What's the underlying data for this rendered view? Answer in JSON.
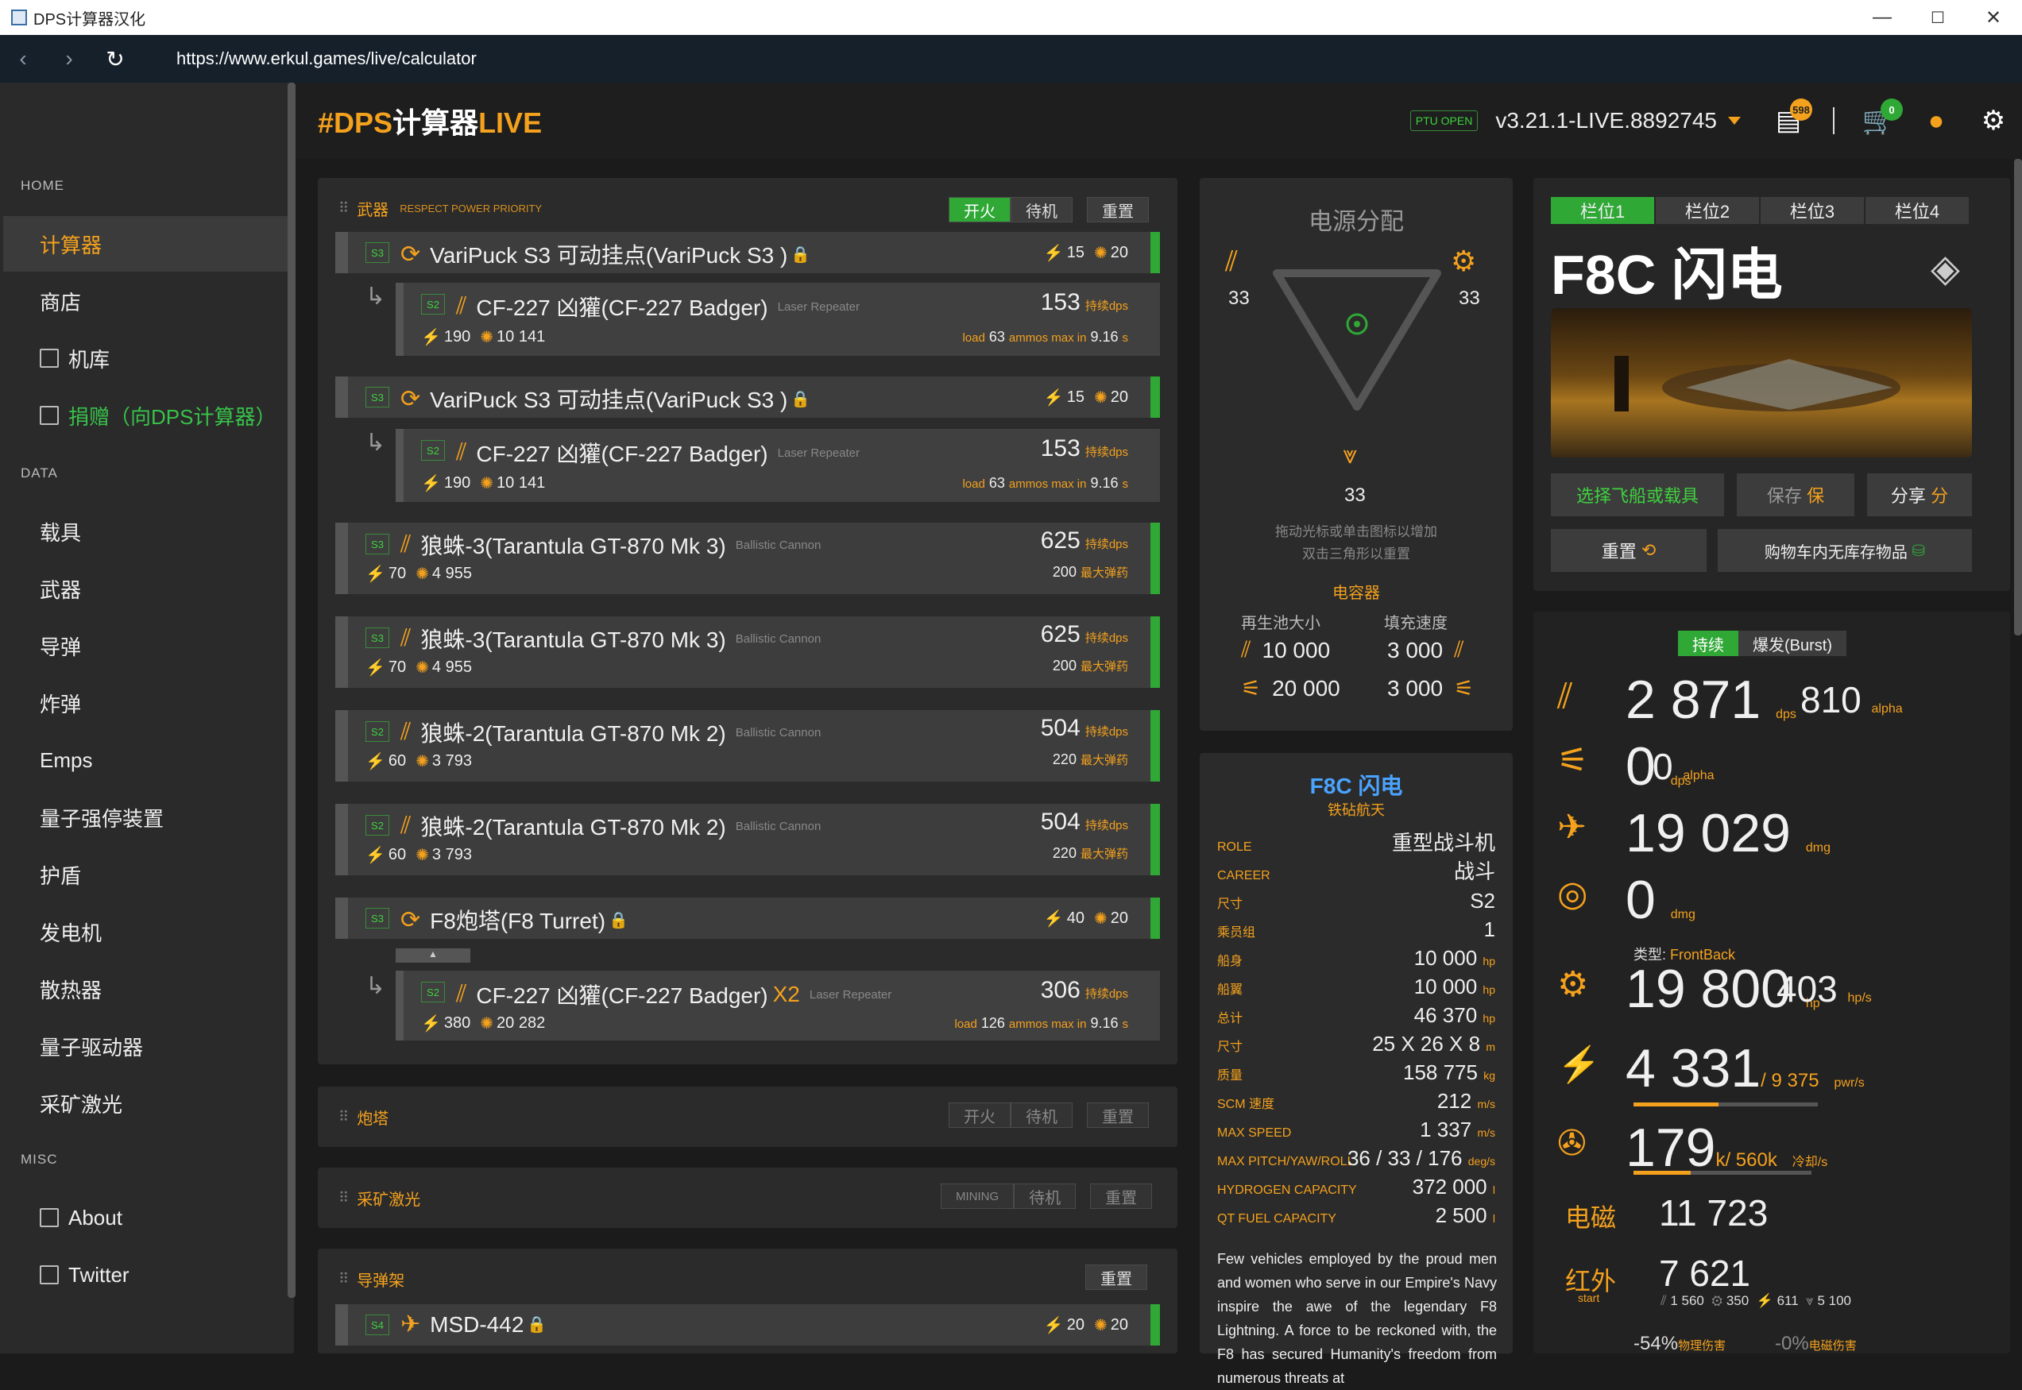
{
  "window": {
    "title": "DPS计算器汉化",
    "controls": [
      "—",
      "☐",
      "✕"
    ]
  },
  "browser": {
    "url": "https://www.erkul.games/live/calculator",
    "back": "‹",
    "forward": "›",
    "reload": "↻"
  },
  "sidebar": {
    "home_label": "HOME",
    "data_label": "DATA",
    "misc_label": "MISC",
    "home_items": [
      "计算器",
      "商店",
      "机库",
      "捐赠（向DPS计算器）"
    ],
    "data_items": [
      "载具",
      "武器",
      "导弹",
      "炸弹",
      "Emps",
      "量子强停装置",
      "护盾",
      "发电机",
      "散热器",
      "量子驱动器",
      "采矿激光"
    ],
    "misc_items": [
      "About",
      "Twitter"
    ]
  },
  "header": {
    "logo_hash": "#DPS",
    "logo_cn": "计算器",
    "logo_live": "LIVE",
    "ptu": "PTU OPEN",
    "version": "v3.21.1-LIVE.8892745",
    "notif_count": "598",
    "cart_count": "0"
  },
  "weapons": {
    "title": "武器",
    "subtitle": "RESPECT POWER PRIORITY",
    "fire": "开火",
    "standby": "待机",
    "reset": "重置",
    "mounts": [
      {
        "size": "S3",
        "name": "VariPuck S3 可动挂点(VariPuck S3 )",
        "power": "15",
        "heat": "20"
      },
      {
        "size": "S3",
        "name": "VariPuck S3 可动挂点(VariPuck S3 )",
        "power": "15",
        "heat": "20"
      },
      {
        "size": "S3",
        "name": "F8炮塔(F8 Turret)",
        "power": "40",
        "heat": "20"
      }
    ],
    "guns": [
      {
        "size": "S2",
        "name": "CF-227 凶獾(CF-227 Badger)",
        "type": "Laser Repeater",
        "dps": "153",
        "dps_label": "持续dps",
        "power": "190",
        "heat": "10 141",
        "load_label": "load",
        "ammo": "63",
        "ammo_label": "ammos max in",
        "time": "9.16",
        "unit": "s"
      },
      {
        "size": "S2",
        "name": "CF-227 凶獾(CF-227 Badger)",
        "type": "Laser Repeater",
        "dps": "153",
        "dps_label": "持续dps",
        "power": "190",
        "heat": "10 141",
        "load_label": "load",
        "ammo": "63",
        "ammo_label": "ammos max in",
        "time": "9.16",
        "unit": "s"
      },
      {
        "size": "S2",
        "name": "CF-227 凶獾(CF-227 Badger)",
        "x2": "X2",
        "type": "Laser Repeater",
        "dps": "306",
        "dps_label": "持续dps",
        "power": "380",
        "heat": "20 282",
        "load_label": "load",
        "ammo": "126",
        "ammo_label": "ammos max in",
        "time": "9.16",
        "unit": "s"
      }
    ],
    "cannons": [
      {
        "size": "S3",
        "name": "狼蛛-3(Tarantula GT-870 Mk 3)",
        "type": "Ballistic Cannon",
        "dps": "625",
        "dps_label": "持续dps",
        "power": "70",
        "heat": "4 955",
        "ammo": "200",
        "ammo_label": "最大弹药"
      },
      {
        "size": "S3",
        "name": "狼蛛-3(Tarantula GT-870 Mk 3)",
        "type": "Ballistic Cannon",
        "dps": "625",
        "dps_label": "持续dps",
        "power": "70",
        "heat": "4 955",
        "ammo": "200",
        "ammo_label": "最大弹药"
      },
      {
        "size": "S2",
        "name": "狼蛛-2(Tarantula GT-870 Mk 2)",
        "type": "Ballistic Cannon",
        "dps": "504",
        "dps_label": "持续dps",
        "power": "60",
        "heat": "3 793",
        "ammo": "220",
        "ammo_label": "最大弹药"
      },
      {
        "size": "S2",
        "name": "狼蛛-2(Tarantula GT-870 Mk 2)",
        "type": "Ballistic Cannon",
        "dps": "504",
        "dps_label": "持续dps",
        "power": "60",
        "heat": "3 793",
        "ammo": "220",
        "ammo_label": "最大弹药"
      }
    ]
  },
  "turrets": {
    "title": "炮塔",
    "fire": "开火",
    "standby": "待机",
    "reset": "重置"
  },
  "mining": {
    "title": "采矿激光",
    "mining": "MINING",
    "standby": "待机",
    "reset": "重置"
  },
  "missiles": {
    "title": "导弹架",
    "reset": "重置",
    "size": "S4",
    "name": "MSD-442",
    "power": "20",
    "heat": "20"
  },
  "power": {
    "title": "电源分配",
    "weapons": "33",
    "shields": "33",
    "thrusters": "33",
    "note1": "拖动光标或单击图标以增加",
    "note2": "双击三角形以重置",
    "capacitor": "电容器",
    "pool_label": "再生池大小",
    "rate_label": "填充速度",
    "wpn_pool": "10 000",
    "wpn_rate": "3 000",
    "thr_pool": "20 000",
    "thr_rate": "3 000"
  },
  "ship_info": {
    "name": "F8C 闪电",
    "maker": "铁砧航天",
    "rows": [
      {
        "k": "ROLE",
        "v": "重型战斗机"
      },
      {
        "k": "CAREER",
        "v": "战斗"
      },
      {
        "k": "尺寸",
        "v": "S2"
      },
      {
        "k": "乘员组",
        "v": "1"
      },
      {
        "k": "船身",
        "v": "10 000",
        "u": "hp"
      },
      {
        "k": "船翼",
        "v": "10 000",
        "u": "hp"
      },
      {
        "k": "总计",
        "v": "46 370",
        "u": "hp"
      },
      {
        "k": "尺寸",
        "v": "25 X 26 X 8",
        "u": "m"
      },
      {
        "k": "质量",
        "v": "158 775",
        "u": "kg"
      },
      {
        "k": "SCM 速度",
        "v": "212",
        "u": "m/s"
      },
      {
        "k": "MAX SPEED",
        "v": "1 337",
        "u": "m/s"
      },
      {
        "k": "MAX PITCH/YAW/ROLL",
        "v": "36 / 33 / 176",
        "u": "deg/s"
      },
      {
        "k": "HYDROGEN CAPACITY",
        "v": "372 000",
        "u": "l"
      },
      {
        "k": "QT FUEL CAPACITY",
        "v": "2 500",
        "u": "l"
      }
    ],
    "desc": "Few vehicles employed by the proud men and women who serve in our Empire's Navy inspire the awe of the legendary F8 Lightning. A force to be reckoned with, the F8 has secured Humanity's freedom from numerous threats at"
  },
  "ship": {
    "tabs": [
      "栏位1",
      "栏位2",
      "栏位3",
      "栏位4"
    ],
    "name": "F8C 闪电",
    "select": "选择飞船或载具",
    "save": "保存",
    "save_glyph": "保",
    "share": "分享",
    "share_glyph": "分",
    "reset": "重置",
    "cart": "购物车内无库存物品"
  },
  "stats": {
    "sustained": "持续",
    "burst": "爆发(Burst)",
    "dps": "2 871",
    "dps_u": "dps",
    "alpha": "810",
    "alpha_u": "alpha",
    "m_dps": "0",
    "m_dps_u": "dps",
    "m_alpha": "0",
    "m_alpha_u": "alpha",
    "missile_dmg": "19 029",
    "dmg_u": "dmg",
    "emp_dmg": "0",
    "emp_u": "dmg",
    "shield_type_label": "类型:",
    "shield_type": "FrontBack",
    "shield_hp": "19 800",
    "hp_u": "hp",
    "shield_regen": "403",
    "regen_u": "hp/s",
    "power": "4 331",
    "power_max": "/ 9 375",
    "power_u": "pwr/s",
    "power_fill": 0.462,
    "cool": "179",
    "cool_k": "k",
    "cool_max": "/ 560k",
    "cool_u": "冷却/s",
    "cool_fill": 0.32,
    "em_label": "电磁",
    "em": "11 723",
    "ir_label": "红外",
    "ir_sub": "start",
    "ir": "7 621",
    "ir_a": "1 560",
    "ir_b": "350",
    "ir_c": "611",
    "ir_d": "5 100",
    "phys_res": "-54%",
    "phys_label": "物理伤害",
    "em_res": "-0%",
    "em_res_label": "电磁伤害"
  }
}
